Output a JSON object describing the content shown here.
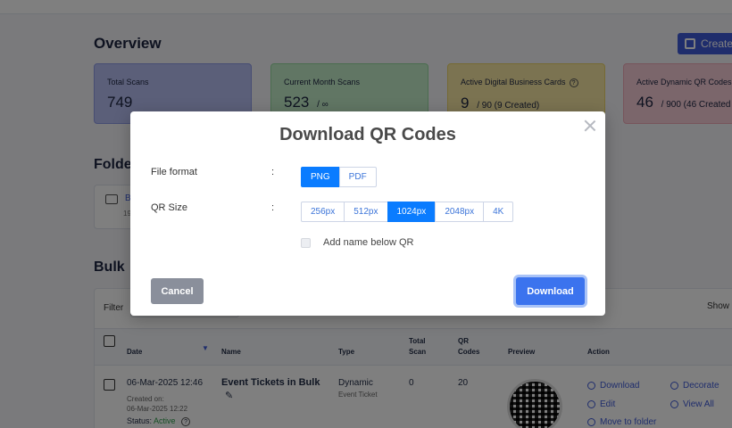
{
  "overview": {
    "title": "Overview",
    "create_label": "Create",
    "cards": [
      {
        "label": "Total Scans",
        "value": "749",
        "suffix": ""
      },
      {
        "label": "Current Month Scans",
        "value": "523",
        "suffix": "/ ∞"
      },
      {
        "label": "Active Digital Business Cards",
        "value": "9",
        "suffix": "/ 90 (9 Created)"
      },
      {
        "label": "Active Dynamic QR Codes",
        "value": "46",
        "suffix": "/ 900 (46 Created"
      }
    ]
  },
  "folders": {
    "title": "Folde",
    "item_label": "B",
    "item_sub": "19"
  },
  "bulk": {
    "title": "Bulk",
    "filter_label": "Filter",
    "show_label": "Show",
    "columns": {
      "date": "Date",
      "name": "Name",
      "type": "Type",
      "total_scan_1": "Total",
      "total_scan_2": "Scan",
      "qr_codes_1": "QR",
      "qr_codes_2": "Codes",
      "preview": "Preview",
      "action": "Action"
    },
    "row": {
      "date": "06-Mar-2025 12:46",
      "created_on_label": "Created on:",
      "created_on": "06-Mar-2025 12:22",
      "status_label": "Status:",
      "status": "Active",
      "name": "Event Tickets in Bulk",
      "type": "Dynamic",
      "subtype": "Event Ticket",
      "total_scan": "0",
      "qr_codes": "20",
      "actions": {
        "download": "Download",
        "decorate": "Decorate",
        "edit": "Edit",
        "view_all": "View All",
        "move": "Move to folder"
      }
    }
  },
  "modal": {
    "title": "Download QR Codes",
    "file_format_label": "File format",
    "qr_size_label": "QR Size",
    "colon": ":",
    "formats": [
      "PNG",
      "PDF"
    ],
    "selected_format": "PNG",
    "sizes": [
      "256px",
      "512px",
      "1024px",
      "2048px",
      "4K"
    ],
    "selected_size": "1024px",
    "add_name_label": "Add name below QR",
    "add_name_checked": false,
    "cancel_label": "Cancel",
    "download_label": "Download"
  },
  "colors": {
    "accent": "#0a7cff",
    "download_button": "#3b73ee",
    "cancel_button": "#8a8f9b",
    "status_active": "#2e9e4a"
  }
}
